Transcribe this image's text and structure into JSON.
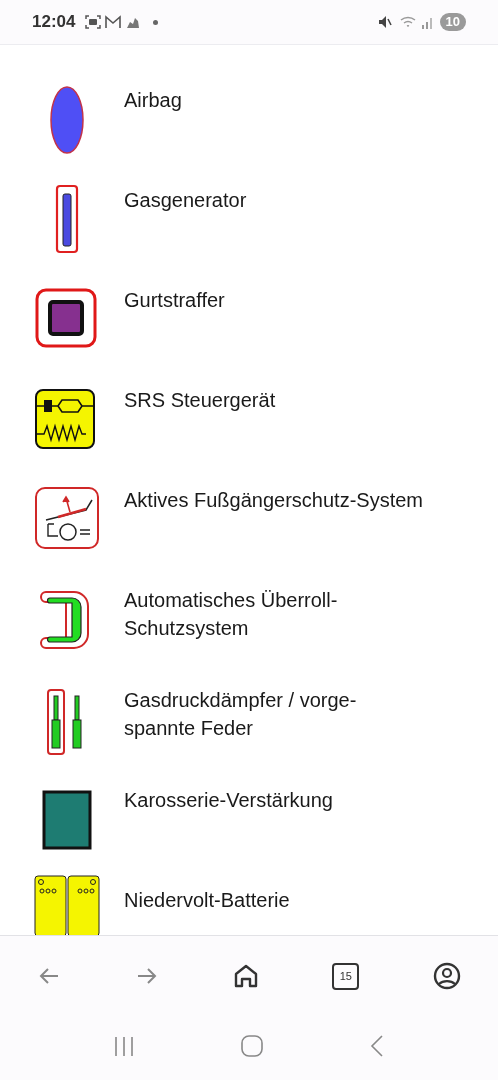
{
  "status_bar": {
    "time": "12:04",
    "notification_count": "10"
  },
  "items": [
    {
      "kind": "airbag",
      "label": "Airbag"
    },
    {
      "kind": "gas_generator",
      "label": "Gasgenerator"
    },
    {
      "kind": "belt_tensioner",
      "label": "Gurtstraffer"
    },
    {
      "kind": "control_unit",
      "label": "SRS Steuergerät"
    },
    {
      "kind": "pedestrian",
      "label": "Aktives Fußgängerschutz-System"
    },
    {
      "kind": "rollover",
      "label": "Automatisches Überroll-Schutzsystem"
    },
    {
      "kind": "strut",
      "label": "Gasdruckdämpfer / vorge-spannte Feder"
    },
    {
      "kind": "reinforcement",
      "label": "Karosserie-Verstärkung"
    },
    {
      "kind": "battery",
      "label": "Niedervolt-Batterie"
    }
  ],
  "browser_bar": {
    "tab_count": "15"
  }
}
